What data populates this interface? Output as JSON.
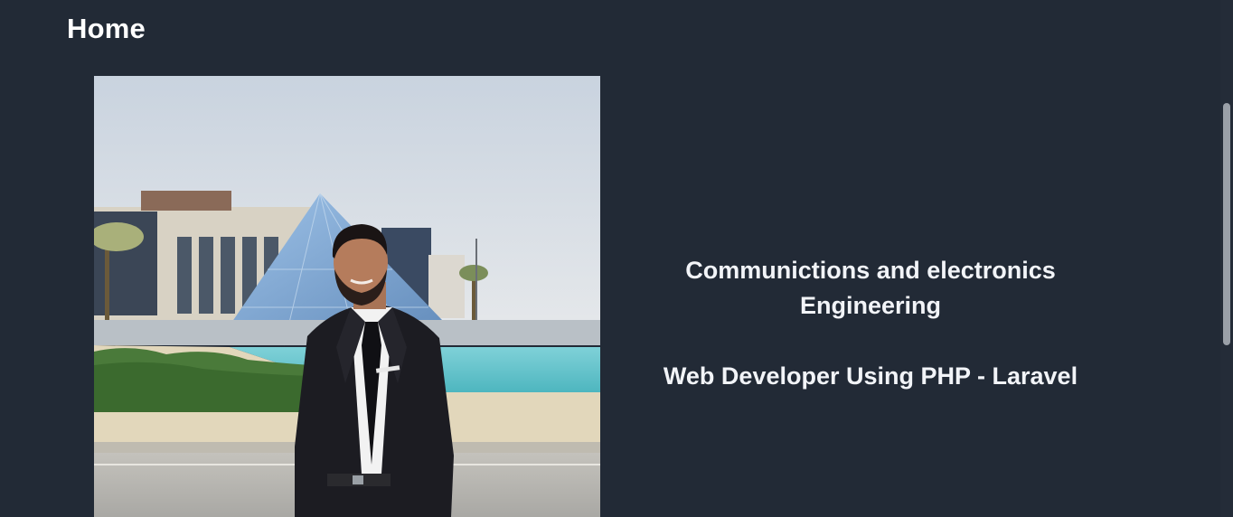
{
  "page": {
    "title": "Home"
  },
  "profile": {
    "photo_description_icon": "profile-photo",
    "bio_line_1": "Communictions and electronics",
    "bio_line_2": "Engineering",
    "bio_line_3": "Web Developer Using PHP - Laravel"
  },
  "colors": {
    "background": "#222a36",
    "text": "#ffffff",
    "scrollbar_thumb": "#9aa0a8"
  }
}
